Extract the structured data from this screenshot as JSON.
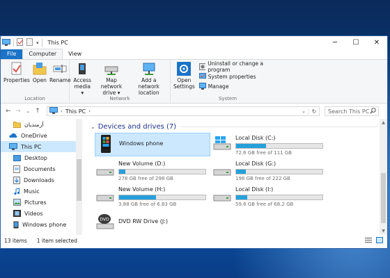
{
  "window": {
    "title": "This PC",
    "minimize": "─",
    "maximize": "☐",
    "close": "✕"
  },
  "tabs": [
    {
      "label": "File"
    },
    {
      "label": "Computer"
    },
    {
      "label": "View"
    }
  ],
  "ribbon": {
    "location": {
      "label": "Location",
      "buttons": [
        {
          "label": "Properties"
        },
        {
          "label": "Open"
        },
        {
          "label": "Rename"
        }
      ]
    },
    "network": {
      "label": "Network",
      "access_media": [
        "Access",
        "media ▾"
      ],
      "map_network_drive": [
        "Map network",
        "drive ▾"
      ],
      "add_network_location": [
        "Add a network",
        "location"
      ]
    },
    "system": {
      "label": "System",
      "open_settings": [
        "Open",
        "Settings"
      ],
      "uninstall": "Uninstall or change a program",
      "system_properties": "System properties",
      "manage": "Manage"
    }
  },
  "address": {
    "back": "←",
    "forward": "→",
    "recent": "⌄",
    "up": "↑",
    "crumb": "This PC",
    "separator": "›",
    "dropdown": "⌄",
    "refresh": "↻",
    "search_placeholder": "Search This PC"
  },
  "nav_items": [
    {
      "label": "آرمندیان"
    },
    {
      "label": "OneDrive"
    },
    {
      "label": "This PC"
    },
    {
      "label": "Desktop"
    },
    {
      "label": "Documents"
    },
    {
      "label": "Downloads"
    },
    {
      "label": "Music"
    },
    {
      "label": "Pictures"
    },
    {
      "label": "Videos"
    },
    {
      "label": "Windows phone"
    }
  ],
  "group": {
    "chevron": "⌄",
    "title": "Devices and drives (7)"
  },
  "drives": [
    {
      "name": "Windows phone",
      "selected": true
    },
    {
      "name": "Local Disk (C:)",
      "free": "72.6 GB free of 111 GB",
      "used_fraction": 0.35
    },
    {
      "name": "New Volume (D:)",
      "free": "278 GB free of 298 GB",
      "used_fraction": 0.07
    },
    {
      "name": "Local Disk (G:)",
      "free": "198 GB free of 222 GB",
      "used_fraction": 0.11
    },
    {
      "name": "New Volume (H:)",
      "free": "3.88 GB free of 6.83 GB",
      "used_fraction": 0.43
    },
    {
      "name": "Local Disk (I:)",
      "free": "59.6 GB free of 68.2 GB",
      "used_fraction": 0.13
    },
    {
      "name": "DVD RW Drive (J:)",
      "badge": "DVD"
    }
  ],
  "status": {
    "items": "13 items",
    "selected": "1 item selected"
  },
  "colors": {
    "accent": "#1a73c7",
    "selection": "#cce8ff",
    "bar_fill": "#26a0da",
    "group_title": "#1e3287"
  }
}
